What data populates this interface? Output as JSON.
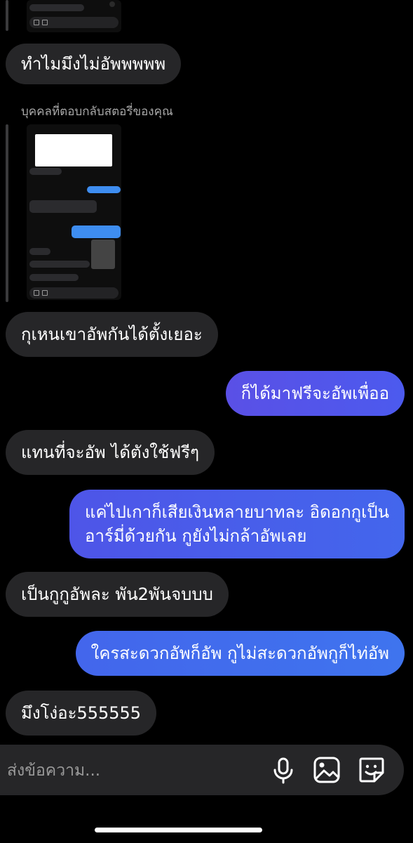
{
  "story_reply_label": "บุคคลที่ตอบกลับสตอรี่ของคุณ",
  "messages": [
    {
      "side": "in",
      "text": "ทำไมมึงไม่อัพพพพพ"
    },
    {
      "side": "in",
      "text": "กุเหนเขาอัพกันได้ตั้งเยอะ"
    },
    {
      "side": "out",
      "text": "ก็ได้มาฟรีจะอัพเพื่ออ"
    },
    {
      "side": "in",
      "text": "แทนที่จะอัพ ได้ตังใช้ฟรีๆ"
    },
    {
      "side": "out",
      "lines": [
        "แค่ไปเกาก็เสียเงินหลายบาทละ อิดอกกูเป็น",
        "อาร์มี่ด้วยกัน กูยังไม่กล้าอัพเลย"
      ]
    },
    {
      "side": "in",
      "text": "เป็นกูกูอัพละ พัน2พันจบบบ"
    },
    {
      "side": "out",
      "text": "ใครสะดวกอัพก็อัพ กูไม่สะดวกอัพกูก็ไท่อัพ"
    },
    {
      "side": "in",
      "text": "มึงโง่อะ555555"
    }
  ],
  "composer": {
    "placeholder": "ส่งข้อความ..."
  },
  "icons": [
    "microphone-icon",
    "gallery-icon",
    "sticker-icon"
  ],
  "colors": {
    "outgoing_start": "#5a50e6",
    "outgoing_end": "#3f74ee",
    "incoming": "#262628"
  }
}
